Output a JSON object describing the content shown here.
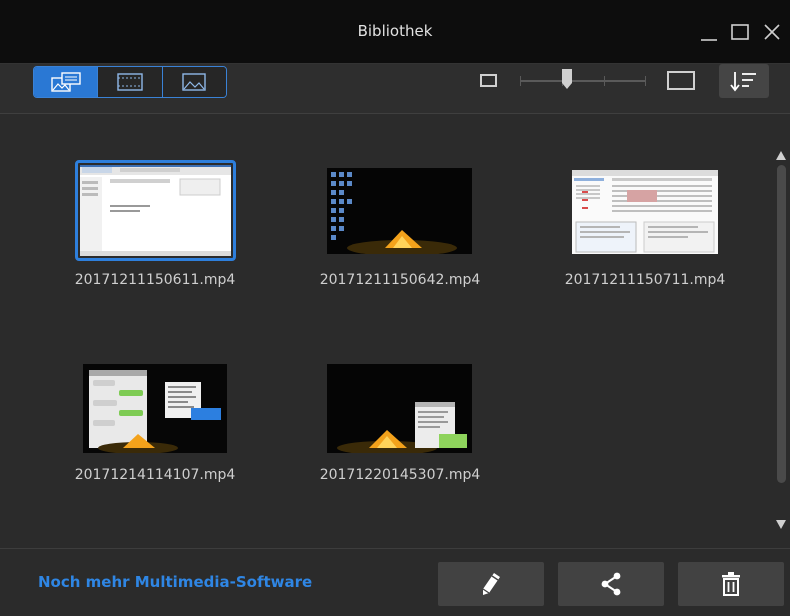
{
  "window": {
    "title": "Bibliothek",
    "controls": [
      "minimize-icon",
      "maximize-icon",
      "close-icon"
    ]
  },
  "toolbar": {
    "view_modes": [
      {
        "name": "thumbnail-view",
        "icon": "thumbnail-grid-icon",
        "active": true
      },
      {
        "name": "video-view",
        "icon": "film-frame-icon",
        "active": false
      },
      {
        "name": "image-view",
        "icon": "landscape-image-icon",
        "active": false
      }
    ],
    "thumbnail_size_fraction": 0.36,
    "sort_icon": "sort-descending-icon"
  },
  "files": [
    {
      "name": "20171211150611.mp4",
      "selected": true,
      "preview": "office-document"
    },
    {
      "name": "20171211150642.mp4",
      "selected": false,
      "preview": "night-desktop-tent"
    },
    {
      "name": "20171211150711.mp4",
      "selected": false,
      "preview": "spreadsheet-window"
    },
    {
      "name": "20171214114107.mp4",
      "selected": false,
      "preview": "chat-window-tent"
    },
    {
      "name": "20171220145307.mp4",
      "selected": false,
      "preview": "dialog-tent"
    }
  ],
  "footer": {
    "more_link": "Noch mehr Multimedia-Software",
    "actions": [
      "edit-pencil-icon",
      "share-icon",
      "trash-icon"
    ]
  },
  "colors": {
    "accent": "#2e7fdc",
    "titlebar": "#0d0d0d",
    "background": "#2b2b2b",
    "button": "#424242"
  }
}
